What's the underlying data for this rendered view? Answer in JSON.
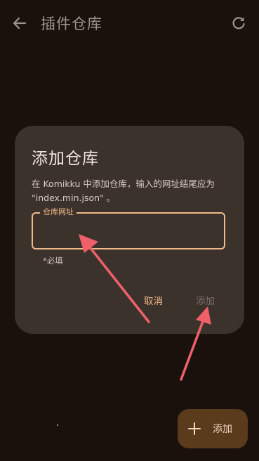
{
  "app_bar": {
    "back_icon": "arrow-left-icon",
    "title": "插件仓库",
    "refresh_icon": "refresh-icon"
  },
  "dialog": {
    "title": "添加仓库",
    "description": "在 Komikku 中添加仓库，输入的网址结尾应为 \"index.min.json\" 。",
    "field_label": "仓库网址",
    "field_value": "",
    "helper_text": "*必填",
    "cancel_label": "取消",
    "add_label": "添加"
  },
  "fab": {
    "icon": "plus-icon",
    "label": "添加"
  },
  "colors": {
    "background": "#1a110c",
    "dialog": "#3c322c",
    "accent": "#f0b98a",
    "annotation_arrow": "#f0606a",
    "fab": "#5a3b1c"
  }
}
